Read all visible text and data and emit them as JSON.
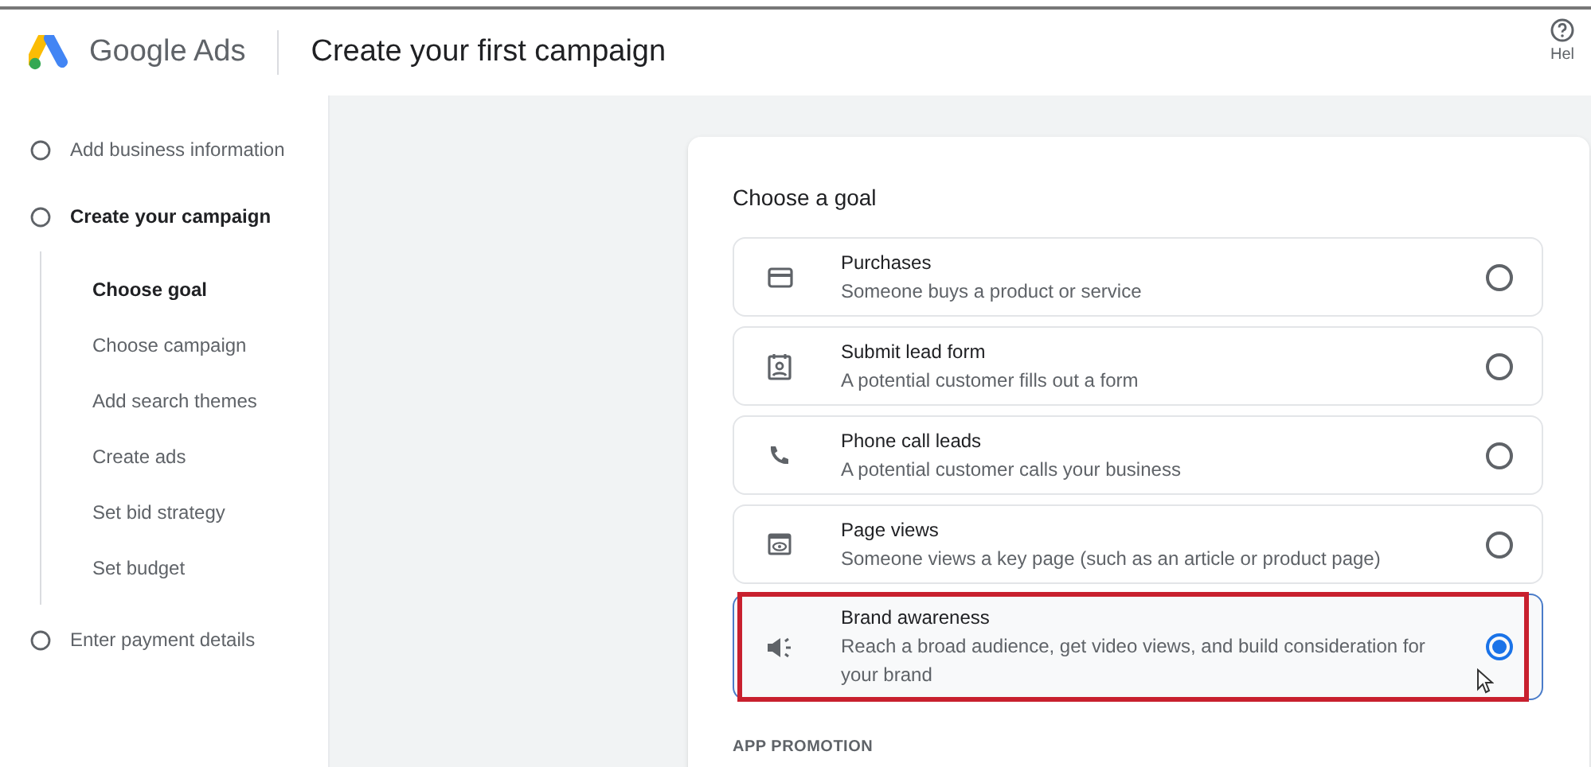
{
  "header": {
    "product": "Google Ads",
    "title": "Create your first campaign",
    "help_label": "Hel"
  },
  "steps": [
    {
      "label": "Add business information",
      "current": false
    },
    {
      "label": "Create your campaign",
      "current": true,
      "children": [
        {
          "label": "Choose goal",
          "current": true
        },
        {
          "label": "Choose campaign",
          "current": false
        },
        {
          "label": "Add search themes",
          "current": false
        },
        {
          "label": "Create ads",
          "current": false
        },
        {
          "label": "Set bid strategy",
          "current": false
        },
        {
          "label": "Set budget",
          "current": false
        }
      ]
    },
    {
      "label": "Enter payment details",
      "current": false
    }
  ],
  "goal_card": {
    "heading": "Choose a goal",
    "goals": [
      {
        "kind": "card",
        "title": "Purchases",
        "description": "Someone buys a product or service",
        "selected": false,
        "highlighted": false
      },
      {
        "kind": "form",
        "title": "Submit lead form",
        "description": "A potential customer fills out a form",
        "selected": false,
        "highlighted": false
      },
      {
        "kind": "phone",
        "title": "Phone call leads",
        "description": "A potential customer calls your business",
        "selected": false,
        "highlighted": false
      },
      {
        "kind": "page",
        "title": "Page views",
        "description": "Someone views a key page (such as an article or product page)",
        "selected": false,
        "highlighted": false
      },
      {
        "kind": "megaphone",
        "title": "Brand awareness",
        "description": "Reach a broad audience, get video views, and build consideration for your brand",
        "selected": true,
        "highlighted": true
      }
    ],
    "section_label": "APP PROMOTION"
  }
}
